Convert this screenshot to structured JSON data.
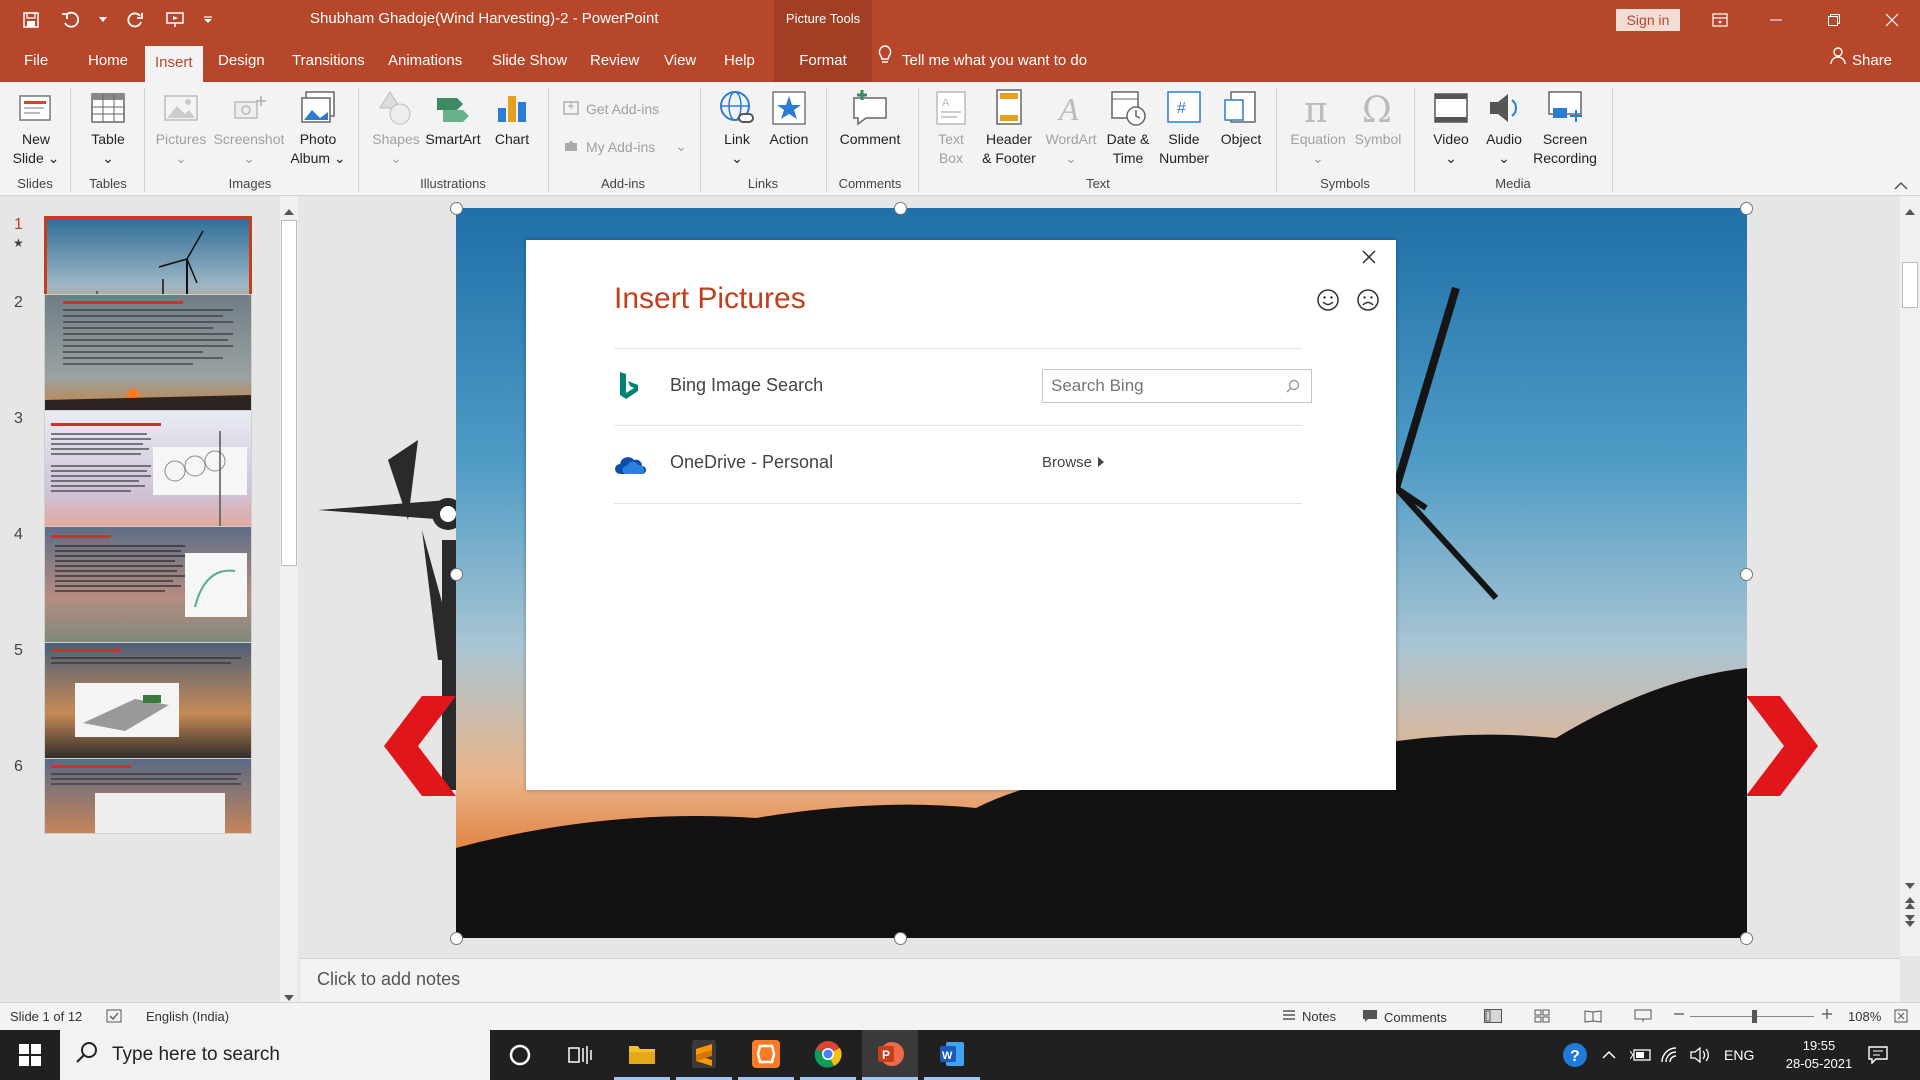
{
  "window": {
    "title": "Shubham Ghadoje(Wind Harvesting)-2  -  PowerPoint",
    "context_header": "Picture Tools",
    "sign_in": "Sign in"
  },
  "tabs": [
    "File",
    "Home",
    "Insert",
    "Design",
    "Transitions",
    "Animations",
    "Slide Show",
    "Review",
    "View",
    "Help",
    "Format"
  ],
  "active_tab": "Insert",
  "tell_me": "Tell me what you want to do",
  "share": "Share",
  "ribbon": {
    "new_slide": [
      "New",
      "Slide"
    ],
    "table": "Table",
    "pictures": "Pictures",
    "screenshot": "Screenshot",
    "photo_album": [
      "Photo",
      "Album"
    ],
    "shapes": "Shapes",
    "smartart": "SmartArt",
    "chart": "Chart",
    "get_addins": "Get Add-ins",
    "my_addins": "My Add-ins",
    "link": "Link",
    "action": "Action",
    "comment": "Comment",
    "text_box": [
      "Text",
      "Box"
    ],
    "header_footer": [
      "Header",
      "& Footer"
    ],
    "wordart": "WordArt",
    "date_time": [
      "Date &",
      "Time"
    ],
    "slide_number": [
      "Slide",
      "Number"
    ],
    "object": "Object",
    "equation": "Equation",
    "symbol": "Symbol",
    "video": "Video",
    "audio": "Audio",
    "screen_recording": [
      "Screen",
      "Recording"
    ],
    "groups": [
      "Slides",
      "Tables",
      "Images",
      "Illustrations",
      "Add-ins",
      "Links",
      "Comments",
      "Text",
      "Symbols",
      "Media"
    ]
  },
  "slides": [
    {
      "num": "1",
      "star": "★"
    },
    {
      "num": "2"
    },
    {
      "num": "3"
    },
    {
      "num": "4"
    },
    {
      "num": "5"
    },
    {
      "num": "6"
    }
  ],
  "dialog": {
    "title": "Insert Pictures",
    "bing_label": "Bing Image Search",
    "search_placeholder": "Search Bing",
    "onedrive_label": "OneDrive - Personal",
    "browse": "Browse"
  },
  "notes_placeholder": "Click to add notes",
  "status": {
    "slide_of": "Slide 1 of 12",
    "language": "English (India)",
    "notes": "Notes",
    "comments": "Comments",
    "zoom": "108%"
  },
  "taskbar": {
    "search_placeholder": "Type here to search",
    "lang": "ENG",
    "time": "19:55",
    "date": "28-05-2021"
  },
  "colors": {
    "accent": "#b7472a",
    "dialog_title": "#c43e1c",
    "arrow_red": "#e0161b"
  }
}
